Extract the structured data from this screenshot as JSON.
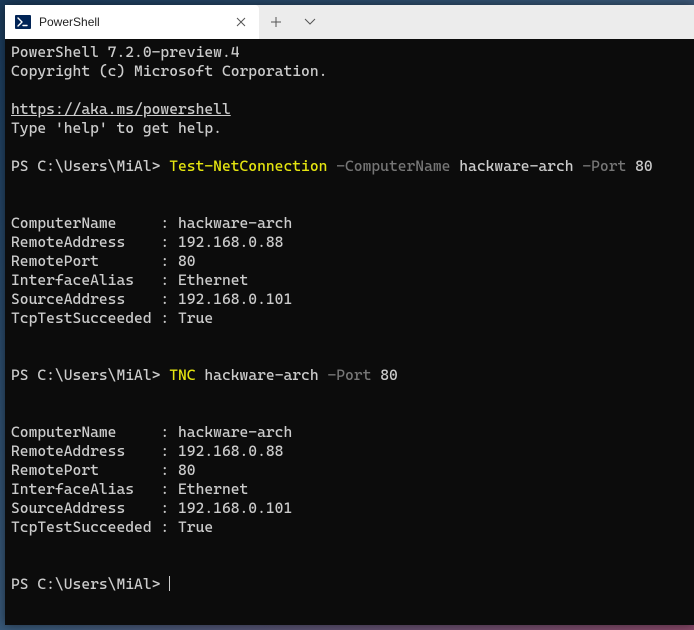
{
  "tab": {
    "title": "PowerShell"
  },
  "banner": {
    "version": "PowerShell 7.2.0-preview.4",
    "copyright": "Copyright (c) Microsoft Corporation.",
    "url": "https://aka.ms/powershell",
    "help": "Type 'help' to get help."
  },
  "prompt": "PS C:\\Users\\MiAl> ",
  "cmd1": {
    "name": "Test-NetConnection",
    "p1_flag": "-ComputerName",
    "p1_val": "hackware-arch",
    "p2_flag": "-Port",
    "p2_val": "80"
  },
  "cmd2": {
    "name": "TNC",
    "p1_val": "hackware-arch",
    "p2_flag": "-Port",
    "p2_val": "80"
  },
  "out": {
    "l1": "ComputerName     : hackware-arch",
    "l2": "RemoteAddress    : 192.168.0.88",
    "l3": "RemotePort       : 80",
    "l4": "InterfaceAlias   : Ethernet",
    "l5": "SourceAddress    : 192.168.0.101",
    "l6": "TcpTestSucceeded : True"
  }
}
